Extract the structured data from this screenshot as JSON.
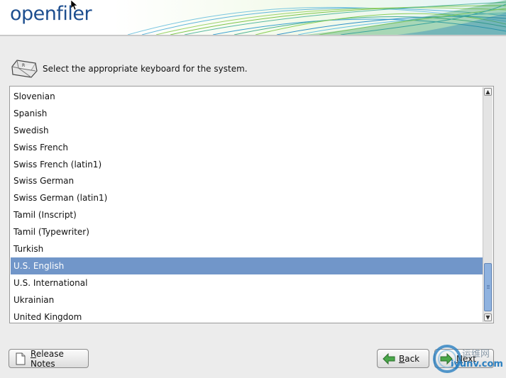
{
  "header": {
    "logo_text": "openfiler"
  },
  "prompt": {
    "text": "Select the appropriate keyboard for the system."
  },
  "keyboard_list": {
    "items": [
      "Slovenian",
      "Spanish",
      "Swedish",
      "Swiss French",
      "Swiss French (latin1)",
      "Swiss German",
      "Swiss German (latin1)",
      "Tamil (Inscript)",
      "Tamil (Typewriter)",
      "Turkish",
      "U.S. English",
      "U.S. International",
      "Ukrainian",
      "United Kingdom"
    ],
    "selected": "U.S. English"
  },
  "buttons": {
    "release_notes": {
      "mnemonic": "R",
      "rest": "elease Notes"
    },
    "back": {
      "mnemonic": "B",
      "rest": "ack"
    },
    "next": {
      "mnemonic": "N",
      "rest": "ext"
    }
  },
  "watermark": {
    "line1": "运维网",
    "line2": "iyunv.com"
  },
  "colors": {
    "selection": "#7196c9",
    "logo": "#1d4e8f",
    "scroll_thumb": "#8fb2df"
  }
}
